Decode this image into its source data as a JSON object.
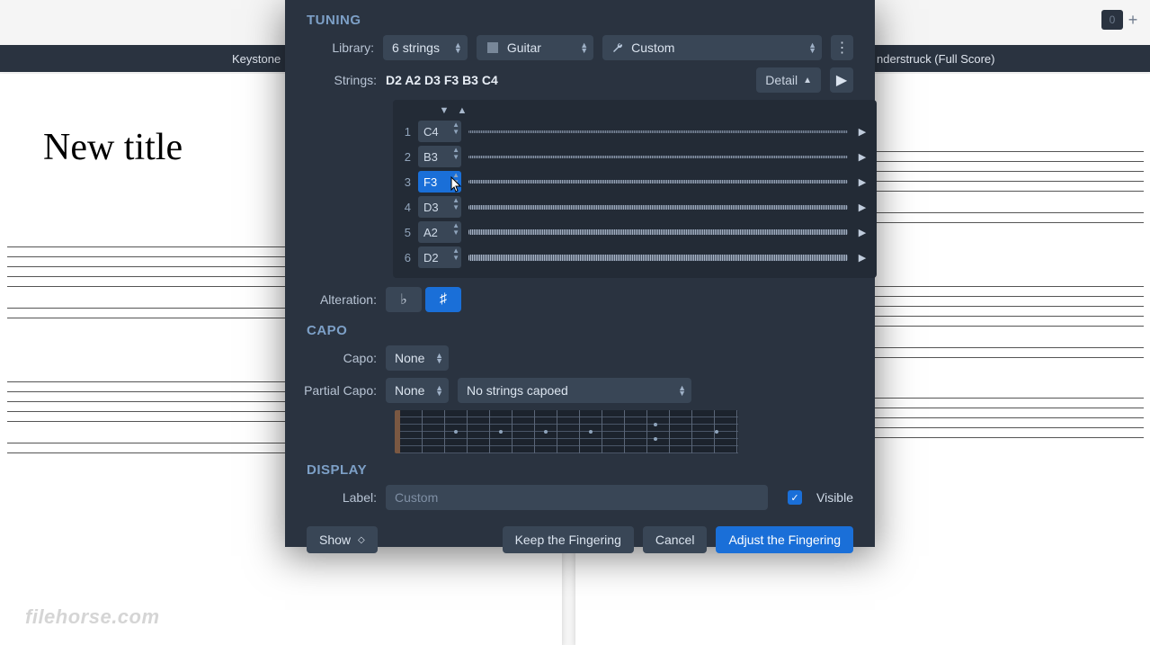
{
  "tabs": {
    "left": "Keystone",
    "right": "nderstruck (Full Score)"
  },
  "page": {
    "title": "New title"
  },
  "topfrag": {
    "value": "0"
  },
  "watermark": "filehorse.com",
  "tuning": {
    "title": "TUNING",
    "library_label": "Library:",
    "string_count": "6 strings",
    "instrument": "Guitar",
    "preset": "Custom",
    "strings_label": "Strings:",
    "strings_value": "D2 A2 D3 F3 B3 C4",
    "detail": "Detail",
    "rows": [
      {
        "n": "1",
        "note": "C4"
      },
      {
        "n": "2",
        "note": "B3"
      },
      {
        "n": "3",
        "note": "F3"
      },
      {
        "n": "4",
        "note": "D3"
      },
      {
        "n": "5",
        "note": "A2"
      },
      {
        "n": "6",
        "note": "D2"
      }
    ],
    "alteration_label": "Alteration:",
    "flat": "♭",
    "sharp": "♯"
  },
  "capo": {
    "title": "CAPO",
    "capo_label": "Capo:",
    "capo_value": "None",
    "partial_label": "Partial Capo:",
    "partial_value": "None",
    "partial_desc": "No strings capoed"
  },
  "display": {
    "title": "DISPLAY",
    "label_label": "Label:",
    "placeholder": "Custom",
    "visible": "Visible"
  },
  "buttons": {
    "show": "Show",
    "keep": "Keep the Fingering",
    "cancel": "Cancel",
    "adjust": "Adjust the Fingering"
  }
}
